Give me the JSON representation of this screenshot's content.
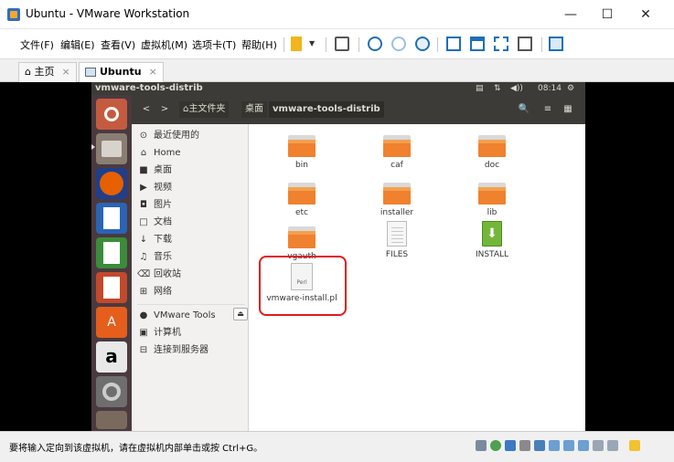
{
  "window": {
    "title": "Ubuntu - VMware Workstation",
    "minimize": "—",
    "maximize": "☐",
    "close": "✕"
  },
  "menu": {
    "items": [
      "文件(F)",
      "编辑(E)",
      "查看(V)",
      "虚拟机(M)",
      "选项卡(T)",
      "帮助(H)"
    ]
  },
  "tabs": {
    "home": "主页",
    "vm": "Ubuntu",
    "close_glyph": "×"
  },
  "ubuntu_panel": {
    "window_name": "vmware-tools-distrib",
    "time": "08:14",
    "network_glyph": "⇅",
    "volume_glyph": "◀))",
    "settings_glyph": "⚙"
  },
  "nautilus": {
    "back": "<",
    "forward": ">",
    "crumbs": [
      "主文件夹",
      "桌面",
      "vmware-tools-distrib"
    ],
    "search_glyph": "🔍",
    "list_glyph": "≡",
    "grid_glyph": "▦"
  },
  "sidebar": {
    "items": [
      {
        "label": "最近使用的",
        "icon": "⊙"
      },
      {
        "label": "Home",
        "icon": "⌂"
      },
      {
        "label": "桌面",
        "icon": "■"
      },
      {
        "label": "视频",
        "icon": "▶"
      },
      {
        "label": "图片",
        "icon": "◘"
      },
      {
        "label": "文档",
        "icon": "□"
      },
      {
        "label": "下载",
        "icon": "↓"
      },
      {
        "label": "音乐",
        "icon": "♫"
      },
      {
        "label": "回收站",
        "icon": "⌫"
      },
      {
        "label": "网络",
        "icon": "⊞"
      }
    ],
    "devices": [
      {
        "label": "VMware Tools",
        "icon": "●"
      },
      {
        "label": "计算机",
        "icon": "▣"
      },
      {
        "label": "连接到服务器",
        "icon": "⊟"
      }
    ],
    "eject_glyph": "⏏"
  },
  "files": [
    {
      "name": "bin",
      "type": "folder"
    },
    {
      "name": "caf",
      "type": "folder"
    },
    {
      "name": "doc",
      "type": "folder"
    },
    {
      "name": "etc",
      "type": "folder"
    },
    {
      "name": "installer",
      "type": "folder"
    },
    {
      "name": "lib",
      "type": "folder"
    },
    {
      "name": "vgauth",
      "type": "folder"
    },
    {
      "name": "FILES",
      "type": "doc"
    },
    {
      "name": "INSTALL",
      "type": "install"
    },
    {
      "name": "vmware-install.pl",
      "type": "perl",
      "badge": "Perl"
    }
  ],
  "status": {
    "message": "要将输入定向到该虚拟机，请在虚拟机内部单击或按 Ctrl+G。"
  },
  "colors": {
    "folder": "#f0812f",
    "ubuntu_panel": "#3c3b37",
    "launcher": "#4a3a40",
    "highlight": "#e01b1b"
  }
}
